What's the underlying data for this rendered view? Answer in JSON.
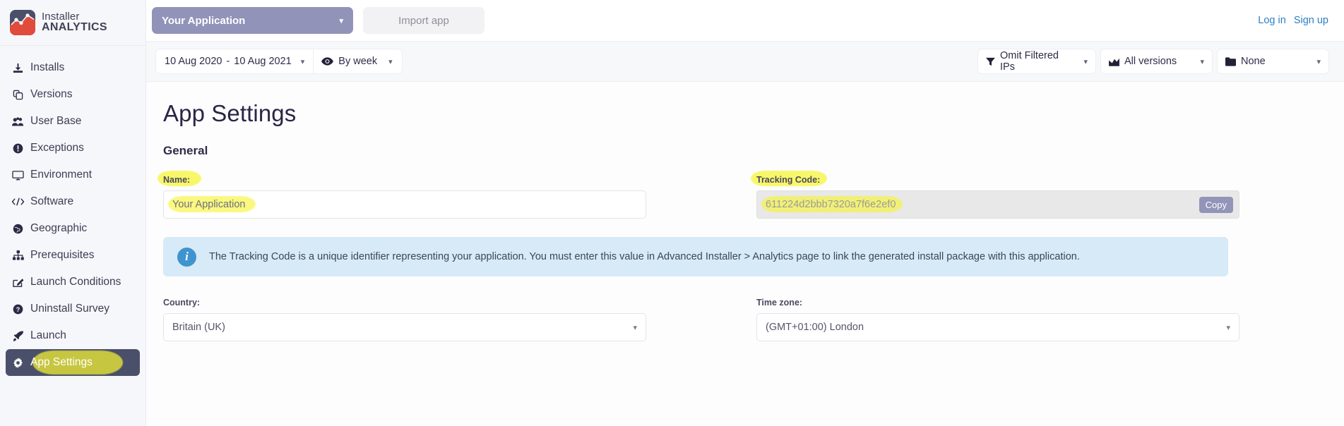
{
  "brand": {
    "line1": "Installer",
    "line2": "ANALYTICS",
    "icon": "chart-logo-icon"
  },
  "sidebar": {
    "items": [
      {
        "label": "Installs",
        "icon": "download-icon",
        "active": false
      },
      {
        "label": "Versions",
        "icon": "copy-icon",
        "active": false
      },
      {
        "label": "User Base",
        "icon": "users-icon",
        "active": false
      },
      {
        "label": "Exceptions",
        "icon": "exclamation-circle-icon",
        "active": false
      },
      {
        "label": "Environment",
        "icon": "desktop-icon",
        "active": false
      },
      {
        "label": "Software",
        "icon": "code-icon",
        "active": false
      },
      {
        "label": "Geographic",
        "icon": "globe-icon",
        "active": false
      },
      {
        "label": "Prerequisites",
        "icon": "sitemap-icon",
        "active": false
      },
      {
        "label": "Launch Conditions",
        "icon": "edit-square-icon",
        "active": false
      },
      {
        "label": "Uninstall Survey",
        "icon": "question-circle-icon",
        "active": false
      },
      {
        "label": "Launch",
        "icon": "rocket-icon",
        "active": false
      },
      {
        "label": "App Settings",
        "icon": "gear-icon",
        "active": true
      }
    ]
  },
  "topbar": {
    "app_selector": "Your Application",
    "import_button": "Import app",
    "login": "Log in",
    "signup": "Sign up"
  },
  "filterbar": {
    "date_from": "10 Aug 2020",
    "date_separator": "-",
    "date_to": "10 Aug 2021",
    "granularity": "By week",
    "granularity_icon": "eye-icon",
    "omit_filtered_ips": "Omit Filtered IPs",
    "omit_icon": "filter-icon",
    "versions": "All versions",
    "versions_icon": "area-chart-icon",
    "folder": "None",
    "folder_icon": "folder-icon"
  },
  "page": {
    "title": "App Settings",
    "section": "General",
    "name_label": "Name:",
    "name_value": "Your Application",
    "tracking_label": "Tracking Code:",
    "tracking_value": "611224d2bbb7320a7f6e2ef0",
    "copy_button": "Copy",
    "banner_text": "The Tracking Code is a unique identifier representing your application. You must enter this value in Advanced Installer > Analytics page to link the generated install package with this application.",
    "country_label": "Country:",
    "country_value": "Britain (UK)",
    "timezone_label": "Time zone:",
    "timezone_value": "(GMT+01:00) London"
  },
  "colors": {
    "accent_purple": "#9193b9",
    "active_nav": "#4a4f6a",
    "link_blue": "#2e7fc4",
    "highlight_yellow": "#f7f531",
    "banner_blue": "#d7eaf7",
    "info_icon_blue": "#3f93cf"
  }
}
